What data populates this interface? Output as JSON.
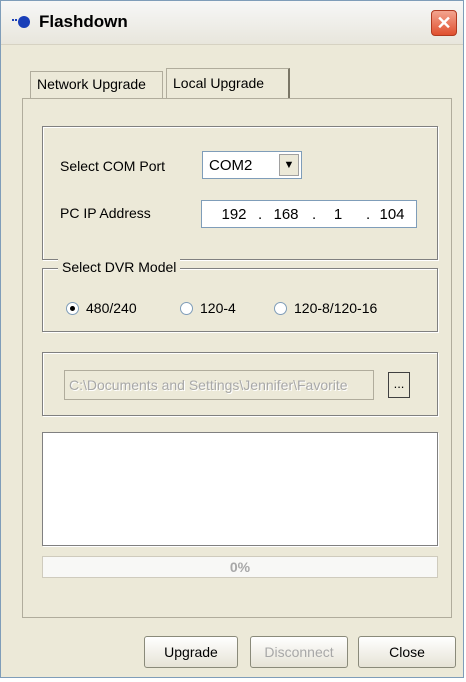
{
  "window": {
    "title": "Flashdown",
    "close_symbol": "✕",
    "icon": "app-icon"
  },
  "tabs": [
    {
      "label": "Network Upgrade",
      "active": false
    },
    {
      "label": "Local Upgrade",
      "active": true
    }
  ],
  "com_section": {
    "com_port_label": "Select COM Port",
    "com_port_value": "COM2",
    "ip_label": "PC IP Address",
    "ip_octets": [
      "192",
      "168",
      "1",
      "104"
    ]
  },
  "dvr_model": {
    "legend": "Select DVR Model",
    "options": [
      {
        "label": "480/240",
        "selected": true
      },
      {
        "label": "120-4",
        "selected": false
      },
      {
        "label": "120-8/120-16",
        "selected": false
      }
    ]
  },
  "file_path": {
    "value": "C:\\Documents and Settings\\Jennifer\\Favorite",
    "browse_label": "..."
  },
  "progress": {
    "text": "0%",
    "value": 0
  },
  "buttons": {
    "upgrade": "Upgrade",
    "disconnect": "Disconnect",
    "close": "Close"
  },
  "colors": {
    "window_bg": "#ece9d8",
    "close_red": "#e0502f",
    "disabled_text": "#a8a8a8"
  }
}
